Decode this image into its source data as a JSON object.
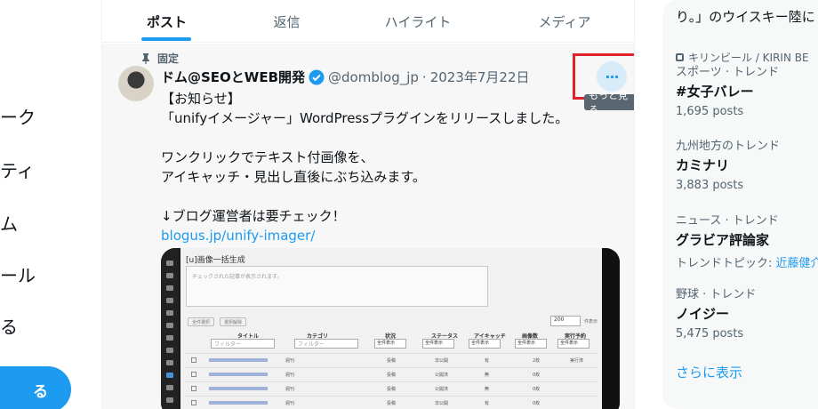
{
  "left_nav": {
    "fragments": [
      "ーク",
      "ティ",
      "ム",
      "ール",
      "る"
    ],
    "post_button_label": "る"
  },
  "tabs": [
    {
      "label": "ポスト",
      "active": true
    },
    {
      "label": "返信",
      "active": false
    },
    {
      "label": "ハイライト",
      "active": false
    },
    {
      "label": "メディア",
      "active": false
    }
  ],
  "tweet": {
    "pinned_label": "固定",
    "author_name": "ドム@SEOとWEB開発",
    "handle": "@domblog_jp",
    "date": "2023年7月22日",
    "separator": "·",
    "lines": [
      "【お知らせ】",
      "「unifyイメージャー」WordPressプラグインをリリースしました。",
      "",
      "ワンクリックでテキスト付画像を、",
      "アイキャッチ・見出し直後にぶち込みます。",
      "",
      "↓ブログ運営者は要チェック！"
    ],
    "link": "blogus.jp/unify-imager/",
    "more_button_glyph": "···",
    "more_tooltip": "もっと見る",
    "accent_color": "#1d9bf0",
    "highlight_color": "#e0222b"
  },
  "media": {
    "title": "[u]画像一括生成",
    "textarea_placeholder": "チェックされた記事が表示されます。",
    "buttons": [
      "全件選択",
      "選択解除"
    ],
    "per_page": "200",
    "per_page_label": "件表示",
    "columns": [
      "タイトル",
      "カテゴリ",
      "状況",
      "ステータス",
      "アイキャッチ",
      "画像数",
      "実行予約"
    ],
    "filter_placeholder": "フィルター",
    "dropdown_label": "全件表示",
    "rows": [
      {
        "category": "週刊",
        "state": "投稿",
        "status": "非公開",
        "eyecatch": "有",
        "images": "2枚",
        "scheduled": "実行済"
      },
      {
        "category": "週刊",
        "state": "投稿",
        "status": "公開済",
        "eyecatch": "無",
        "images": "0枚",
        "scheduled": ""
      },
      {
        "category": "週刊",
        "state": "投稿",
        "status": "公開済",
        "eyecatch": "無",
        "images": "0枚",
        "scheduled": ""
      },
      {
        "category": "週刊",
        "state": "投稿",
        "status": "非公開",
        "eyecatch": "有",
        "images": "0枚",
        "scheduled": ""
      }
    ]
  },
  "right": {
    "top_text": "り。」のウイスキー陸に",
    "top_sponsor": "キリンビール / KIRIN BE",
    "trends": [
      {
        "category": "スポーツ · トレンド",
        "title": "#女子バレー",
        "count": "1,695 posts",
        "link": ""
      },
      {
        "category": "九州地方のトレンド",
        "title": "カミナリ",
        "count": "3,883 posts",
        "link": ""
      },
      {
        "category": "ニュース · トレンド",
        "title": "グラビア評論家",
        "count": "トレンドトピック: ",
        "link": "近藤健介"
      },
      {
        "category": "野球 · トレンド",
        "title": "ノイジー",
        "count": "5,475 posts",
        "link": ""
      }
    ],
    "show_more": "さらに表示"
  }
}
